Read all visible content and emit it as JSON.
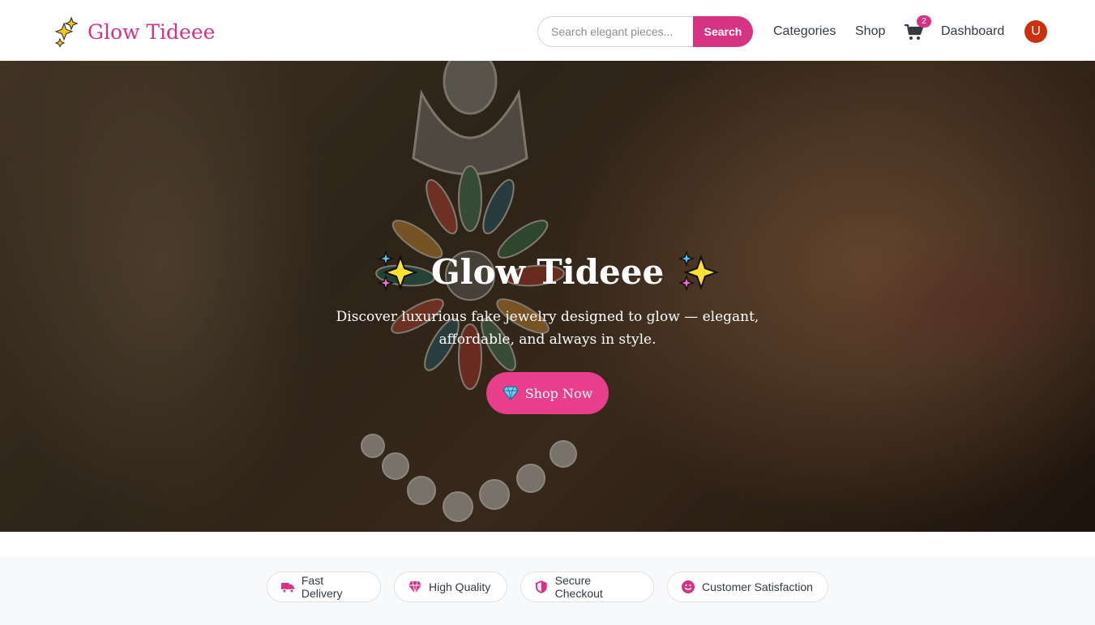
{
  "brand": {
    "name": "Glow Tideee",
    "accent_color": "#d63384",
    "icon": "sparkles-icon"
  },
  "search": {
    "placeholder": "Search elegant pieces...",
    "button_label": "Search"
  },
  "nav": {
    "categories": "Categories",
    "shop": "Shop",
    "cart_count": "2",
    "dashboard": "Dashboard",
    "avatar_initial": "U"
  },
  "hero": {
    "title": "Glow Tideee",
    "subtitle": "Discover luxurious fake jewelry designed to glow — elegant, affordable, and always in style.",
    "cta_label": "Shop Now",
    "cta_icon": "gem-icon"
  },
  "features": [
    {
      "label": "Fast Delivery",
      "icon": "truck-icon"
    },
    {
      "label": "High Quality",
      "icon": "gem-icon"
    },
    {
      "label": "Secure Checkout",
      "icon": "shield-icon"
    },
    {
      "label": "Customer Satisfaction",
      "icon": "smile-icon"
    }
  ]
}
